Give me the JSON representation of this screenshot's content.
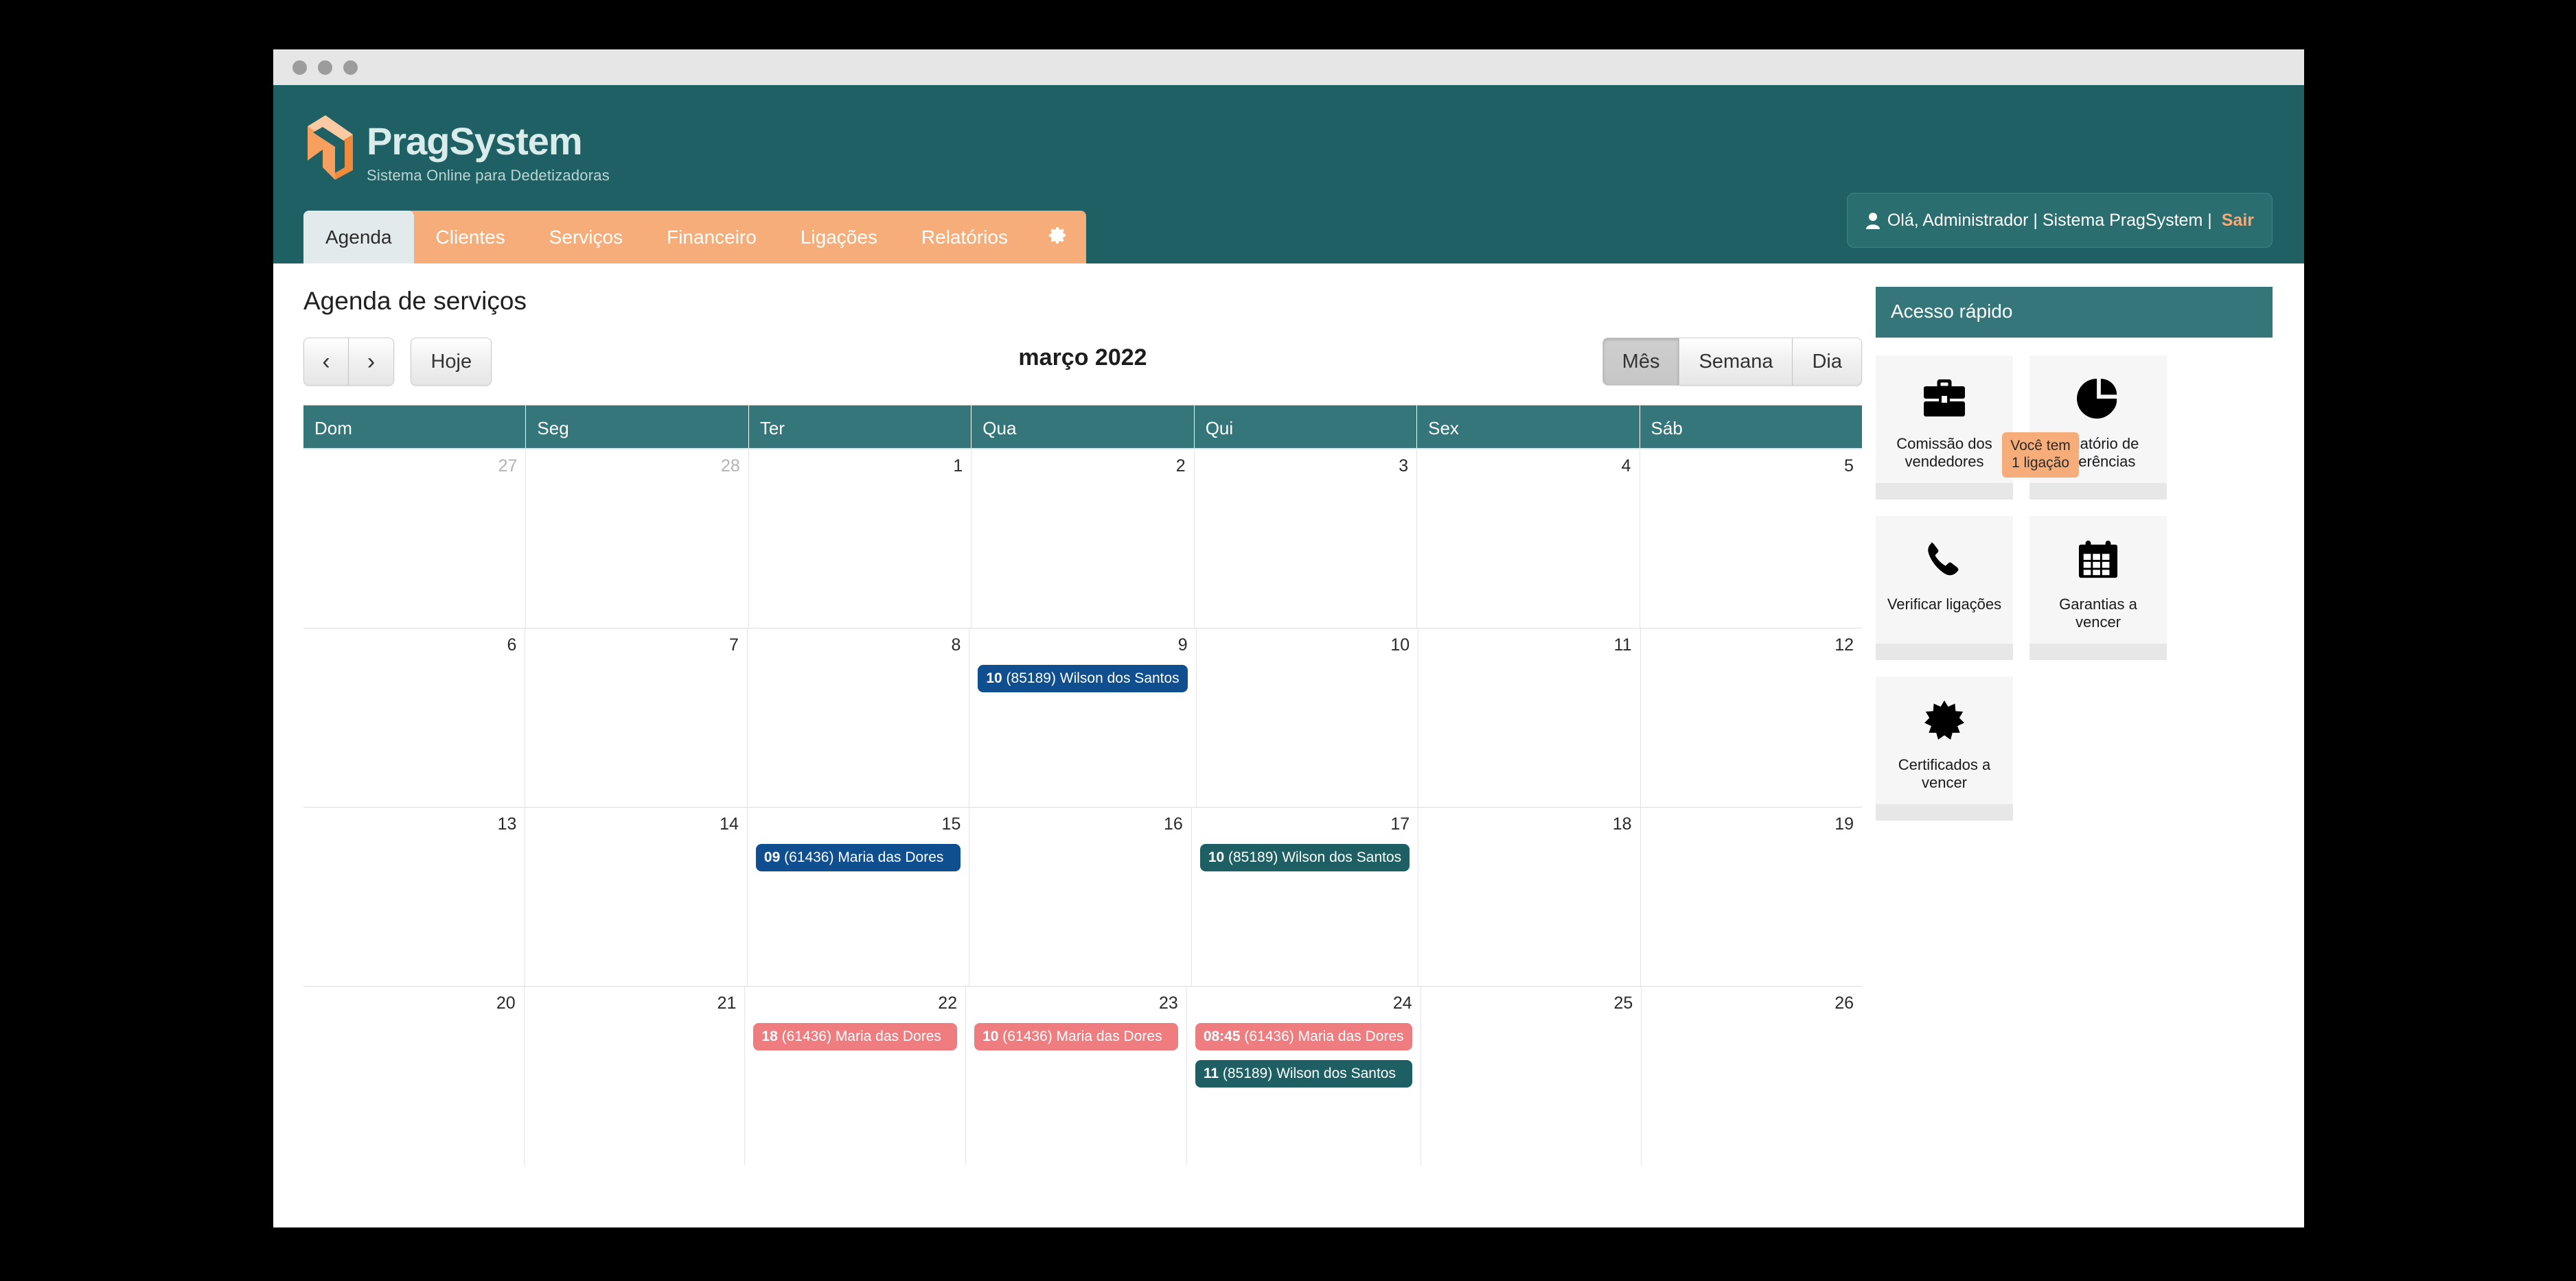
{
  "window": {
    "traffic_lights": [
      "close",
      "minimize",
      "maximize"
    ]
  },
  "brand": {
    "title": "PragSystem",
    "subtitle": "Sistema Online para Dedetizadoras",
    "logo_icon": "pragsystem-logo-icon"
  },
  "user_bar": {
    "user_icon": "user-icon",
    "greeting": "Olá, Administrador | Sistema PragSystem |",
    "logout_label": "Sair"
  },
  "nav": {
    "items": [
      {
        "label": "Agenda",
        "active": true
      },
      {
        "label": "Clientes",
        "active": false
      },
      {
        "label": "Serviços",
        "active": false
      },
      {
        "label": "Financeiro",
        "active": false
      },
      {
        "label": "Ligações",
        "active": false
      },
      {
        "label": "Relatórios",
        "active": false
      }
    ],
    "settings_icon": "gear-icon"
  },
  "main": {
    "page_title": "Agenda de serviços",
    "toolbar": {
      "prev_label": "‹",
      "next_label": "›",
      "today_label": "Hoje",
      "views": [
        {
          "label": "Mês",
          "active": true
        },
        {
          "label": "Semana",
          "active": false
        },
        {
          "label": "Dia",
          "active": false
        }
      ]
    },
    "calendar": {
      "title": "março 2022",
      "weekdays": [
        "Dom",
        "Seg",
        "Ter",
        "Qua",
        "Qui",
        "Sex",
        "Sáb"
      ],
      "weeks": [
        [
          {
            "day": "27",
            "other_month": true,
            "events": []
          },
          {
            "day": "28",
            "other_month": true,
            "events": []
          },
          {
            "day": "1",
            "other_month": false,
            "events": []
          },
          {
            "day": "2",
            "other_month": false,
            "events": []
          },
          {
            "day": "3",
            "other_month": false,
            "events": []
          },
          {
            "day": "4",
            "other_month": false,
            "events": []
          },
          {
            "day": "5",
            "other_month": false,
            "events": []
          }
        ],
        [
          {
            "day": "6",
            "other_month": false,
            "events": []
          },
          {
            "day": "7",
            "other_month": false,
            "events": []
          },
          {
            "day": "8",
            "other_month": false,
            "events": []
          },
          {
            "day": "9",
            "other_month": false,
            "events": [
              {
                "time": "10",
                "text": "(85189) Wilson dos Santos",
                "color": "blue"
              }
            ]
          },
          {
            "day": "10",
            "other_month": false,
            "events": []
          },
          {
            "day": "11",
            "other_month": false,
            "events": []
          },
          {
            "day": "12",
            "other_month": false,
            "events": []
          }
        ],
        [
          {
            "day": "13",
            "other_month": false,
            "events": []
          },
          {
            "day": "14",
            "other_month": false,
            "events": []
          },
          {
            "day": "15",
            "other_month": false,
            "events": [
              {
                "time": "09",
                "text": "(61436) Maria das Dores",
                "color": "blue"
              }
            ]
          },
          {
            "day": "16",
            "other_month": false,
            "events": []
          },
          {
            "day": "17",
            "other_month": false,
            "events": [
              {
                "time": "10",
                "text": "(85189) Wilson dos Santos",
                "color": "teal"
              }
            ]
          },
          {
            "day": "18",
            "other_month": false,
            "events": []
          },
          {
            "day": "19",
            "other_month": false,
            "events": []
          }
        ],
        [
          {
            "day": "20",
            "other_month": false,
            "events": []
          },
          {
            "day": "21",
            "other_month": false,
            "events": []
          },
          {
            "day": "22",
            "other_month": false,
            "events": [
              {
                "time": "18",
                "text": "(61436) Maria das Dores",
                "color": "red"
              }
            ]
          },
          {
            "day": "23",
            "other_month": false,
            "events": [
              {
                "time": "10",
                "text": "(61436) Maria das Dores",
                "color": "red"
              }
            ]
          },
          {
            "day": "24",
            "other_month": false,
            "events": [
              {
                "time": "08:45",
                "text": "(61436) Maria das Dores",
                "color": "red"
              },
              {
                "time": "11",
                "text": "(85189) Wilson dos Santos",
                "color": "teal"
              }
            ]
          },
          {
            "day": "25",
            "other_month": false,
            "events": []
          },
          {
            "day": "26",
            "other_month": false,
            "events": []
          }
        ]
      ]
    }
  },
  "sidebar": {
    "title": "Acesso rápido",
    "tooltip": "Você tem 1 ligação",
    "tiles": [
      {
        "label": "Comissão dos vendedores",
        "icon": "briefcase-icon"
      },
      {
        "label": "Relatório de referências",
        "icon": "pie-chart-icon"
      },
      {
        "label": "Verificar ligações",
        "icon": "phone-icon"
      },
      {
        "label": "Garantias a vencer",
        "icon": "calendar-icon"
      },
      {
        "label": "Certificados a vencer",
        "icon": "starburst-seal-icon"
      }
    ]
  },
  "colors": {
    "teal_header": "#1e6063",
    "teal_band": "#347679",
    "orange_nav": "#f7ad79",
    "event_blue": "#0f4e8f",
    "event_teal": "#1d5f62",
    "event_red": "#ef7d80",
    "link_orange": "#f7a977"
  }
}
